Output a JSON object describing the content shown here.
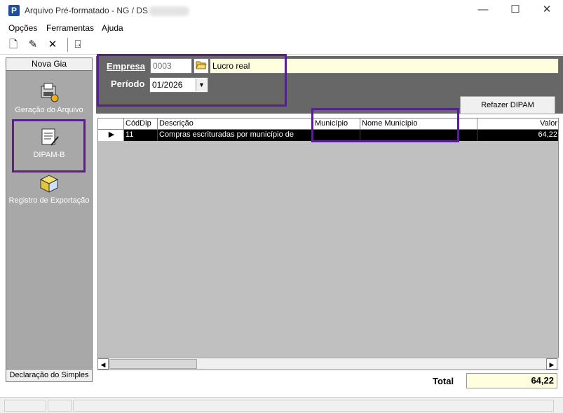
{
  "window": {
    "title": "Arquivo Pré-formatado - NG / DS",
    "app_icon_letter": "P",
    "minimize": "—",
    "maximize": "☐",
    "close": "✕"
  },
  "menu": {
    "items": [
      "Opções",
      "Ferramentas",
      "Ajuda"
    ]
  },
  "toolbar": {
    "new_icon": "🗋",
    "edit_icon": "✎",
    "delete_icon": "✕",
    "exit_icon": "⍈"
  },
  "sidebar": {
    "header": "Nova Gia",
    "footer": "Declaração do Simples",
    "items": [
      {
        "label": "Geração do Arquivo",
        "icon": "disk-printer-icon"
      },
      {
        "label": "DIPAM-B",
        "icon": "document-pen-icon"
      },
      {
        "label": "Registro de Exportação",
        "icon": "export-box-icon"
      }
    ]
  },
  "form": {
    "empresa_label": "Empresa",
    "empresa_code": "0003",
    "empresa_name": "Lucro real",
    "periodo_label": "Período",
    "periodo_value": "01/2026",
    "refazer_button": "Refazer DIPAM"
  },
  "grid": {
    "columns": [
      "CódDip",
      "Descrição",
      "Município",
      "Nome Município",
      "",
      "Valor"
    ],
    "rows": [
      {
        "coddip": "11",
        "descricao": "Compras escrituradas por município de",
        "municipio": "",
        "nome_municipio": "",
        "valor": "64,22"
      }
    ]
  },
  "totals": {
    "label": "Total",
    "value": "64,22"
  },
  "colors": {
    "highlight": "#5a1f8c",
    "panel": "#676767",
    "sidebar": "#a8a8a8",
    "total_bg": "#ffffe0",
    "selected_row": "#000000"
  }
}
